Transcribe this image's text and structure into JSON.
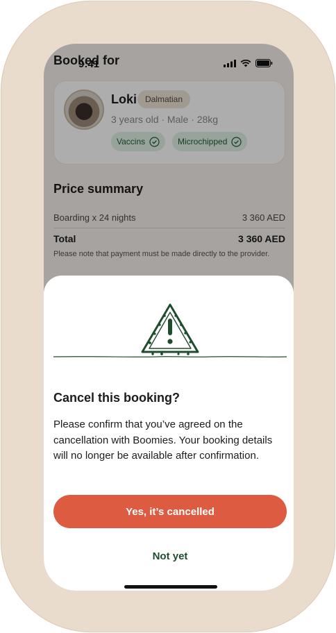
{
  "status_bar": {
    "time": "9:41"
  },
  "booking": {
    "section_title": "Booked for",
    "pet": {
      "name": "Loki",
      "breed": "Dalmatian",
      "meta": "3 years old · Male · 28kg",
      "chips": [
        "Vaccins",
        "Microchipped"
      ]
    }
  },
  "price_summary": {
    "title": "Price summary",
    "items": [
      {
        "label": "Boarding x 24 nights",
        "amount": "3 360 AED"
      }
    ],
    "total_label": "Total",
    "total_amount": "3 360 AED",
    "note": "Please note that payment must be made directly to the provider."
  },
  "cancel_sheet": {
    "title": "Cancel this booking?",
    "body": "Please confirm that you’ve agreed on the cancellation with Boomies. Your booking details will no longer be available after confirmation.",
    "confirm_label": "Yes, it’s cancelled",
    "dismiss_label": "Not yet"
  },
  "colors": {
    "frame": "#e9dccd",
    "accent_button": "#dc5b41",
    "dark_green": "#1e4d2e",
    "chip_bg": "#dff0e5",
    "breed_bg": "#ece3d4"
  },
  "icons": {
    "chip_check": "check-circle-icon",
    "warning": "warning-triangle-icon"
  }
}
